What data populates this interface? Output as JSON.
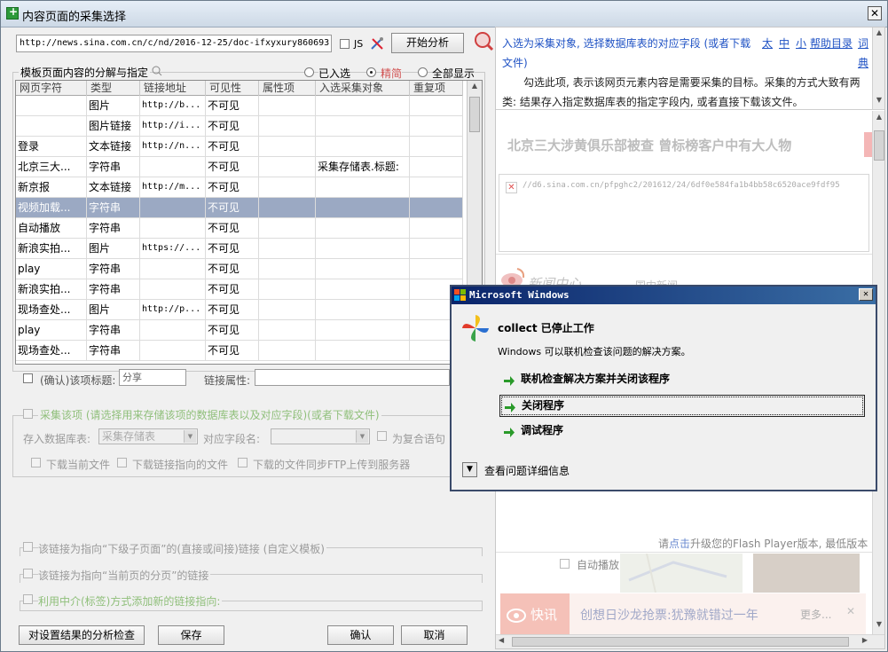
{
  "window": {
    "title": "内容页面的采集选择",
    "close": "✕"
  },
  "top": {
    "url": "http://news.sina.com.cn/c/nd/2016-12-25/doc-ifxyxury860693",
    "js_label": "JS",
    "analyze_button": "开始分析"
  },
  "group1": {
    "title": "模板页面内容的分解与指定",
    "radios": [
      "已入选",
      "精简",
      "全部显示"
    ],
    "selected_radio": "精简"
  },
  "table": {
    "headers": [
      "网页字符",
      "类型",
      "链接地址",
      "可见性",
      "属性项",
      "入选采集对象",
      "重复项"
    ],
    "rows": [
      [
        "",
        "图片",
        "http://b...",
        "不可见",
        "",
        "",
        ""
      ],
      [
        "",
        "图片链接",
        "http://i...",
        "不可见",
        "",
        "",
        ""
      ],
      [
        "登录",
        "文本链接",
        "http://n...",
        "不可见",
        "",
        "",
        ""
      ],
      [
        "北京三大...",
        "字符串",
        "",
        "不可见",
        "",
        "采集存储表.标题:",
        ""
      ],
      [
        "新京报",
        "文本链接",
        "http://m...",
        "不可见",
        "",
        "",
        ""
      ],
      [
        "视频加载...",
        "字符串",
        "",
        "不可见",
        "",
        "",
        ""
      ],
      [
        "自动播放",
        "字符串",
        "",
        "不可见",
        "",
        "",
        ""
      ],
      [
        "新浪实拍...",
        "图片",
        "https://...",
        "不可见",
        "",
        "",
        ""
      ],
      [
        "play",
        "字符串",
        "",
        "不可见",
        "",
        "",
        ""
      ],
      [
        "新浪实拍...",
        "字符串",
        "",
        "不可见",
        "",
        "",
        ""
      ],
      [
        "现场查处...",
        "图片",
        "http://p...",
        "不可见",
        "",
        "",
        ""
      ],
      [
        "play",
        "字符串",
        "",
        "不可见",
        "",
        "",
        ""
      ],
      [
        "现场查处...",
        "字符串",
        "",
        "不可见",
        "",
        "",
        ""
      ]
    ],
    "selected_row": 5
  },
  "title_row": {
    "label": "(确认)该项标题:",
    "value": "分享",
    "link_attr_label": "链接属性:"
  },
  "collect": {
    "title": "采集该项 (请选择用来存储该项的数据库表以及对应字段)(或者下载文件)",
    "db_label": "存入数据库表:",
    "db_value": "采集存储表",
    "field_label": "对应字段名:",
    "composite_label": "为复合语句",
    "opt1": "下载当前文件",
    "opt2": "下载链接指向的文件",
    "opt3": "下载的文件同步FTP上传到服务器"
  },
  "links": {
    "l1": "该链接为指向“下级子页面”的(直接或间接)链接 (自定义模板)",
    "l2": "该链接为指向“当前页的分页”的链接",
    "l3": "利用中介(标签)方式添加新的链接指向:"
  },
  "bottom": {
    "check": "对设置结果的分析检查",
    "save": "保存",
    "ok": "确认",
    "cancel": "取消"
  },
  "help": {
    "line1a": "入选为采集对象, 选择数据库表的对应字段 (或者下载",
    "line1b": "文件)",
    "l_tai": "太",
    "l_zhong": "中",
    "l_xiao": "小",
    "l_help": "帮助目录",
    "l_dict1": "词",
    "l_dict2": "典",
    "para": "勾选此项, 表示该网页元素内容是需要采集的目标。采集的方式大致有两类: 结果存入指定数据库表的指定字段内, 或者直接下载该文件。"
  },
  "preview": {
    "headline": "北京三大涉黄俱乐部被查 曾标榜客户中有大人物",
    "img_url": "//d6.sina.com.cn/pfpghc2/201612/24/6df0e584fa1b4bb58c6520ace9fdf95",
    "news_center": "新闻中心",
    "domestic": "国内新闻",
    "flash_a": "请",
    "flash_link": "点击",
    "flash_b": "升级您的Flash Player版本, 最低版本",
    "autoplay": "自动播放",
    "kuaixun": "快讯",
    "ticker": "创想日沙龙抢票:犹豫就错过一年",
    "more": "更多..."
  },
  "dialog": {
    "title": "Microsoft Windows",
    "heading": "collect 已停止工作",
    "sub": "Windows 可以联机检查该问题的解决方案。",
    "opt1": "联机检查解决方案并关闭该程序",
    "opt2": "关闭程序",
    "opt3": "调试程序",
    "details": "查看问题详细信息"
  }
}
